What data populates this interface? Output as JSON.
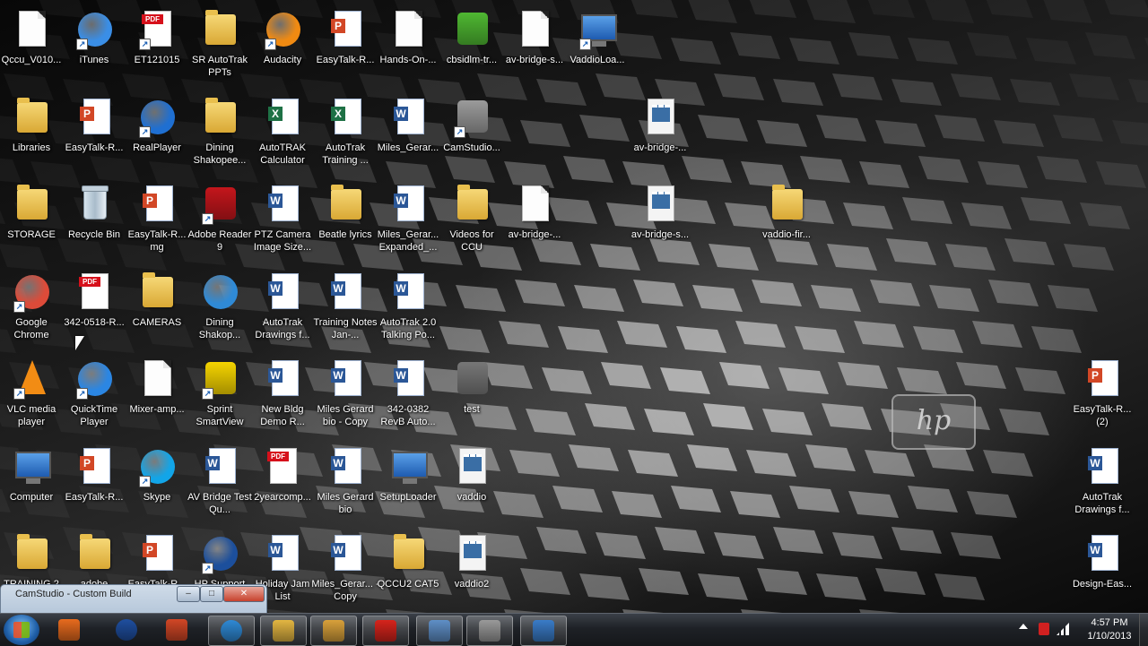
{
  "desktop": {
    "icons": [
      {
        "label": "Qccu_V010...",
        "icon": "document-icon",
        "kind": "doc"
      },
      {
        "label": "iTunes",
        "icon": "itunes-icon",
        "kind": "circle",
        "color": "#3a8ee6",
        "shortcut": true
      },
      {
        "label": "ET121015",
        "icon": "pdf-icon",
        "kind": "pdf",
        "shortcut": true
      },
      {
        "label": "SR AutoTrak PPTs",
        "icon": "folder-icon",
        "kind": "folder"
      },
      {
        "label": "Audacity",
        "icon": "audacity-icon",
        "kind": "circle",
        "color": "#f08a12",
        "shortcut": true
      },
      {
        "label": "EasyTalk-R...",
        "icon": "powerpoint-icon",
        "kind": "ppt"
      },
      {
        "label": "Hands-On-...",
        "icon": "document-icon",
        "kind": "doc"
      },
      {
        "label": "cbsidlm-tr...",
        "icon": "installer-icon",
        "kind": "box",
        "color": "#4fb832"
      },
      {
        "label": "av-bridge-s...",
        "icon": "document-icon",
        "kind": "doc"
      },
      {
        "label": "VaddioLoa...",
        "icon": "network-icon",
        "kind": "monitor",
        "shortcut": true
      },
      {
        "label": "Libraries",
        "icon": "libraries-icon",
        "kind": "folder"
      },
      {
        "label": "EasyTalk-R...",
        "icon": "powerpoint-icon",
        "kind": "ppt"
      },
      {
        "label": "RealPlayer",
        "icon": "realplayer-icon",
        "kind": "circle",
        "color": "#1f6fd1",
        "shortcut": true
      },
      {
        "label": "Dining Shakopee...",
        "icon": "folder-icon",
        "kind": "folder"
      },
      {
        "label": "AutoTRAK Calculator",
        "icon": "excel-icon",
        "kind": "excel"
      },
      {
        "label": "AutoTrak Training ...",
        "icon": "excel-icon",
        "kind": "excel"
      },
      {
        "label": "Miles_Gerar...",
        "icon": "word-icon",
        "kind": "word"
      },
      {
        "label": "CamStudio...",
        "icon": "camstudio-icon",
        "kind": "box",
        "color": "#9b9b9b",
        "shortcut": true
      },
      {
        "label": "av-bridge-...",
        "icon": "avi-video-icon",
        "kind": "avi"
      },
      {
        "label": "STORAGE",
        "icon": "folder-icon",
        "kind": "folder"
      },
      {
        "label": "Recycle Bin",
        "icon": "recycle-bin-icon",
        "kind": "bin"
      },
      {
        "label": "EasyTalk-R... mg",
        "icon": "powerpoint-icon",
        "kind": "ppt"
      },
      {
        "label": "Adobe Reader 9",
        "icon": "adobe-reader-icon",
        "kind": "box",
        "color": "#c4161c",
        "shortcut": true
      },
      {
        "label": "PTZ Camera Image Size...",
        "icon": "word-icon",
        "kind": "word"
      },
      {
        "label": "Beatle lyrics",
        "icon": "folder-icon",
        "kind": "folder"
      },
      {
        "label": "Miles_Gerar... Expanded_...",
        "icon": "word-icon",
        "kind": "word"
      },
      {
        "label": "Videos for CCU",
        "icon": "folder-icon",
        "kind": "folder"
      },
      {
        "label": "av-bridge-...",
        "icon": "document-icon",
        "kind": "doc"
      },
      {
        "label": "av-bridge-s...",
        "icon": "avi-video-icon",
        "kind": "avi"
      },
      {
        "label": "vaddio-fir...",
        "icon": "zip-icon",
        "kind": "folder"
      },
      {
        "label": "Google Chrome",
        "icon": "chrome-icon",
        "kind": "circle",
        "color": "#dd4b39",
        "shortcut": true
      },
      {
        "label": "342-0518-R...",
        "icon": "pdf-icon",
        "kind": "pdf"
      },
      {
        "label": "CAMERAS",
        "icon": "folder-icon",
        "kind": "folder"
      },
      {
        "label": "Dining Shakop...",
        "icon": "internet-explorer-icon",
        "kind": "circle",
        "color": "#2f8ad6"
      },
      {
        "label": "AutoTrak Drawings f...",
        "icon": "word-icon",
        "kind": "word"
      },
      {
        "label": "Training Notes Jan-...",
        "icon": "word-icon",
        "kind": "word"
      },
      {
        "label": "AutoTrak 2.0 Talking Po...",
        "icon": "word-icon",
        "kind": "word"
      },
      {
        "label": "VLC media player",
        "icon": "vlc-icon",
        "kind": "cone",
        "shortcut": true
      },
      {
        "label": "QuickTime Player",
        "icon": "quicktime-icon",
        "kind": "circle",
        "color": "#2b86e3",
        "shortcut": true
      },
      {
        "label": "Mixer-amp...",
        "icon": "mp3-icon",
        "kind": "doc"
      },
      {
        "label": "Sprint SmartView",
        "icon": "sprint-icon",
        "kind": "box",
        "color": "#f5d400",
        "shortcut": true
      },
      {
        "label": "New Bldg Demo R...",
        "icon": "word-icon",
        "kind": "word"
      },
      {
        "label": "Miles Gerard bio - Copy",
        "icon": "word-icon",
        "kind": "word"
      },
      {
        "label": "342-0382 RevB Auto...",
        "icon": "word-icon",
        "kind": "word"
      },
      {
        "label": "test",
        "icon": "video-folder-icon",
        "kind": "box",
        "color": "#777777"
      },
      {
        "label": "EasyTalk-R... (2)",
        "icon": "powerpoint-icon",
        "kind": "ppt"
      },
      {
        "label": "Computer",
        "icon": "computer-icon",
        "kind": "monitor"
      },
      {
        "label": "EasyTalk-R...",
        "icon": "powerpoint-icon",
        "kind": "ppt"
      },
      {
        "label": "Skype",
        "icon": "skype-icon",
        "kind": "circle",
        "color": "#12a5e8",
        "shortcut": true
      },
      {
        "label": "AV Bridge Test Qu...",
        "icon": "word-icon",
        "kind": "word"
      },
      {
        "label": "2yearcomp...",
        "icon": "pdf-icon",
        "kind": "pdf"
      },
      {
        "label": "Miles Gerard bio",
        "icon": "word-icon",
        "kind": "word"
      },
      {
        "label": "SetupLoader",
        "icon": "setup-icon",
        "kind": "monitor"
      },
      {
        "label": "vaddio",
        "icon": "avi-video-icon",
        "kind": "avi"
      },
      {
        "label": "AutoTrak Drawings f...",
        "icon": "word-icon",
        "kind": "word"
      },
      {
        "label": "TRAINING 2",
        "icon": "folder-icon",
        "kind": "folder"
      },
      {
        "label": "adobe",
        "icon": "folder-icon",
        "kind": "folder"
      },
      {
        "label": "EasyTalk-R...",
        "icon": "powerpoint-icon",
        "kind": "ppt"
      },
      {
        "label": "HP Support Assistant",
        "icon": "hp-support-icon",
        "kind": "circle",
        "color": "#1c4f9c",
        "shortcut": true
      },
      {
        "label": "Holiday Jam List",
        "icon": "word-icon",
        "kind": "word"
      },
      {
        "label": "Miles_Gerar... - Copy",
        "icon": "word-icon",
        "kind": "word"
      },
      {
        "label": "QCCU2 CAT5",
        "icon": "folder-icon",
        "kind": "folder"
      },
      {
        "label": "vaddio2",
        "icon": "avi-video-icon",
        "kind": "avi"
      },
      {
        "label": "Design-Eas...",
        "icon": "word-icon",
        "kind": "word"
      }
    ],
    "watermark": "hp"
  },
  "camstudio_window": {
    "title": "CamStudio - Custom Build",
    "min_label": "–",
    "max_label": "□",
    "close_label": "✕"
  },
  "taskbar": {
    "start_icon": "windows-start-icon",
    "items": [
      {
        "name": "media-player-icon",
        "color": "#e86b1e"
      },
      {
        "name": "hp-icon",
        "color": "#1f4fa0"
      },
      {
        "name": "powerpoint-icon",
        "color": "#d24726"
      },
      {
        "name": "internet-explorer-icon",
        "color": "#2f8ad6"
      },
      {
        "name": "explorer-folder-icon",
        "color": "#e3b642"
      },
      {
        "name": "slideshow-icon",
        "color": "#d9a13b"
      },
      {
        "name": "kaspersky-icon",
        "color": "#d6241c"
      },
      {
        "name": "network-monitor-icon",
        "color": "#5f8fc7"
      },
      {
        "name": "camstudio-icon",
        "color": "#9a9a9a"
      },
      {
        "name": "fast-forward-icon",
        "color": "#3a7cc8"
      }
    ],
    "clock": {
      "time": "4:57 PM",
      "date": "1/10/2013"
    }
  },
  "colors": {
    "text": "#ffffff",
    "taskbar": "#1e2126",
    "accent": "#2b5797"
  }
}
